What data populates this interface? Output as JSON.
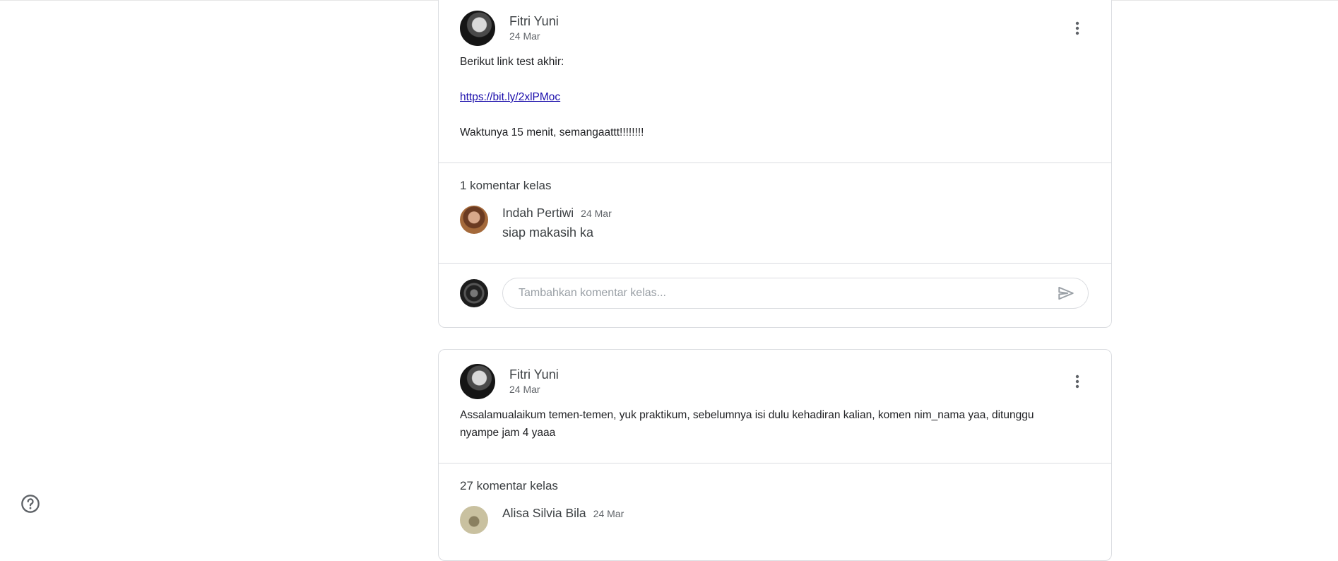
{
  "posts": [
    {
      "author": "Fitri Yuni",
      "date": "24 Mar",
      "body_line1": "Berikut link test akhir:",
      "link": "https://bit.ly/2xlPMoc",
      "body_line2": "Waktunya 15 menit, semangaattt!!!!!!!!",
      "comments_count_label": "1 komentar kelas",
      "comments": [
        {
          "author": "Indah Pertiwi",
          "date": "24 Mar",
          "text": "siap makasih ka"
        }
      ],
      "add_comment_placeholder": "Tambahkan komentar kelas..."
    },
    {
      "author": "Fitri Yuni",
      "date": "24 Mar",
      "body": "Assalamualaikum temen-temen, yuk praktikum, sebelumnya isi dulu kehadiran kalian, komen nim_nama yaa, ditunggu nyampe jam 4 yaaa",
      "comments_count_label": "27 komentar kelas",
      "comments": [
        {
          "author": "Alisa Silvia Bila",
          "date": "24 Mar"
        }
      ]
    }
  ],
  "icons": {
    "more": "more-vert-icon",
    "send": "send-icon",
    "help": "help-circle-icon"
  },
  "colors": {
    "link": "#1a0dab",
    "border": "#dadce0",
    "text_secondary": "#5f6368"
  }
}
